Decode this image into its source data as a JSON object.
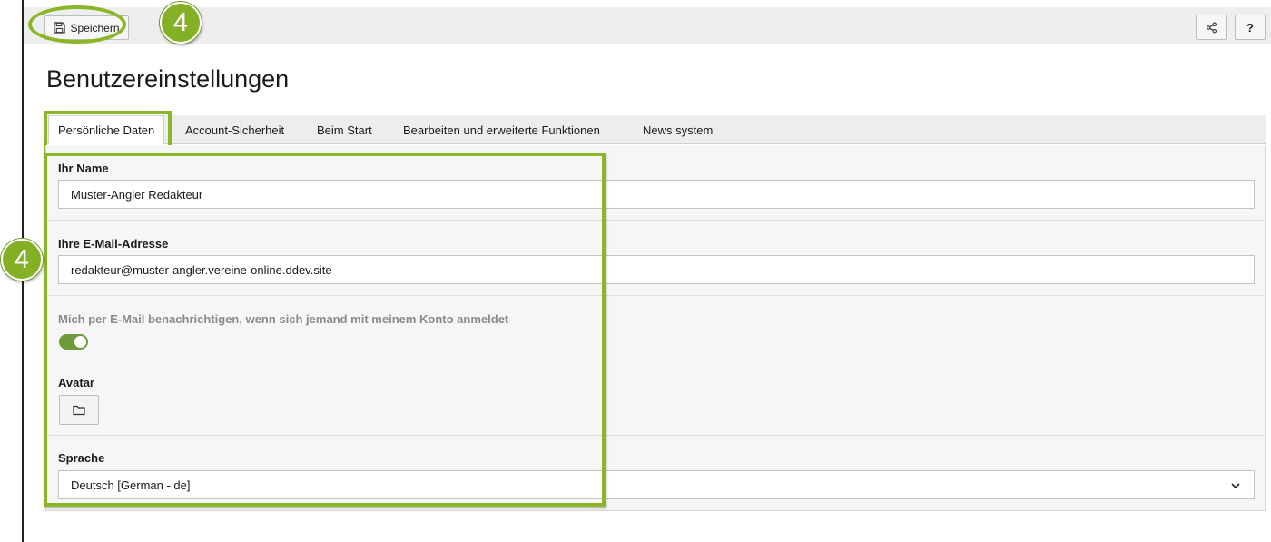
{
  "toolbar": {
    "save_label": "Speichern",
    "help_label": "?",
    "callout_number": "4"
  },
  "page": {
    "title": "Benutzereinstellungen"
  },
  "tabs": [
    {
      "label": "Persönliche Daten",
      "active": true
    },
    {
      "label": "Account-Sicherheit",
      "active": false
    },
    {
      "label": "Beim Start",
      "active": false
    },
    {
      "label": "Bearbeiten und erweiterte Funktionen",
      "active": false
    },
    {
      "label": "News system",
      "active": false
    }
  ],
  "form": {
    "name": {
      "label": "Ihr Name",
      "value": "Muster-Angler Redakteur"
    },
    "email": {
      "label": "Ihre E-Mail-Adresse",
      "value": "redakteur@muster-angler.vereine-online.ddev.site"
    },
    "notify": {
      "label": "Mich per E-Mail benachrichtigen, wenn sich jemand mit meinem Konto anmeldet",
      "enabled": true
    },
    "avatar": {
      "label": "Avatar"
    },
    "language": {
      "label": "Sprache",
      "value": "Deutsch [German - de]"
    }
  },
  "callout": {
    "number": "4"
  },
  "colors": {
    "highlight": "#8ab627",
    "badge": "#84b026",
    "toggle_on": "#6f9a3a"
  },
  "icons": [
    "save-icon",
    "share-icon",
    "folder-icon",
    "chevron-down-icon"
  ]
}
